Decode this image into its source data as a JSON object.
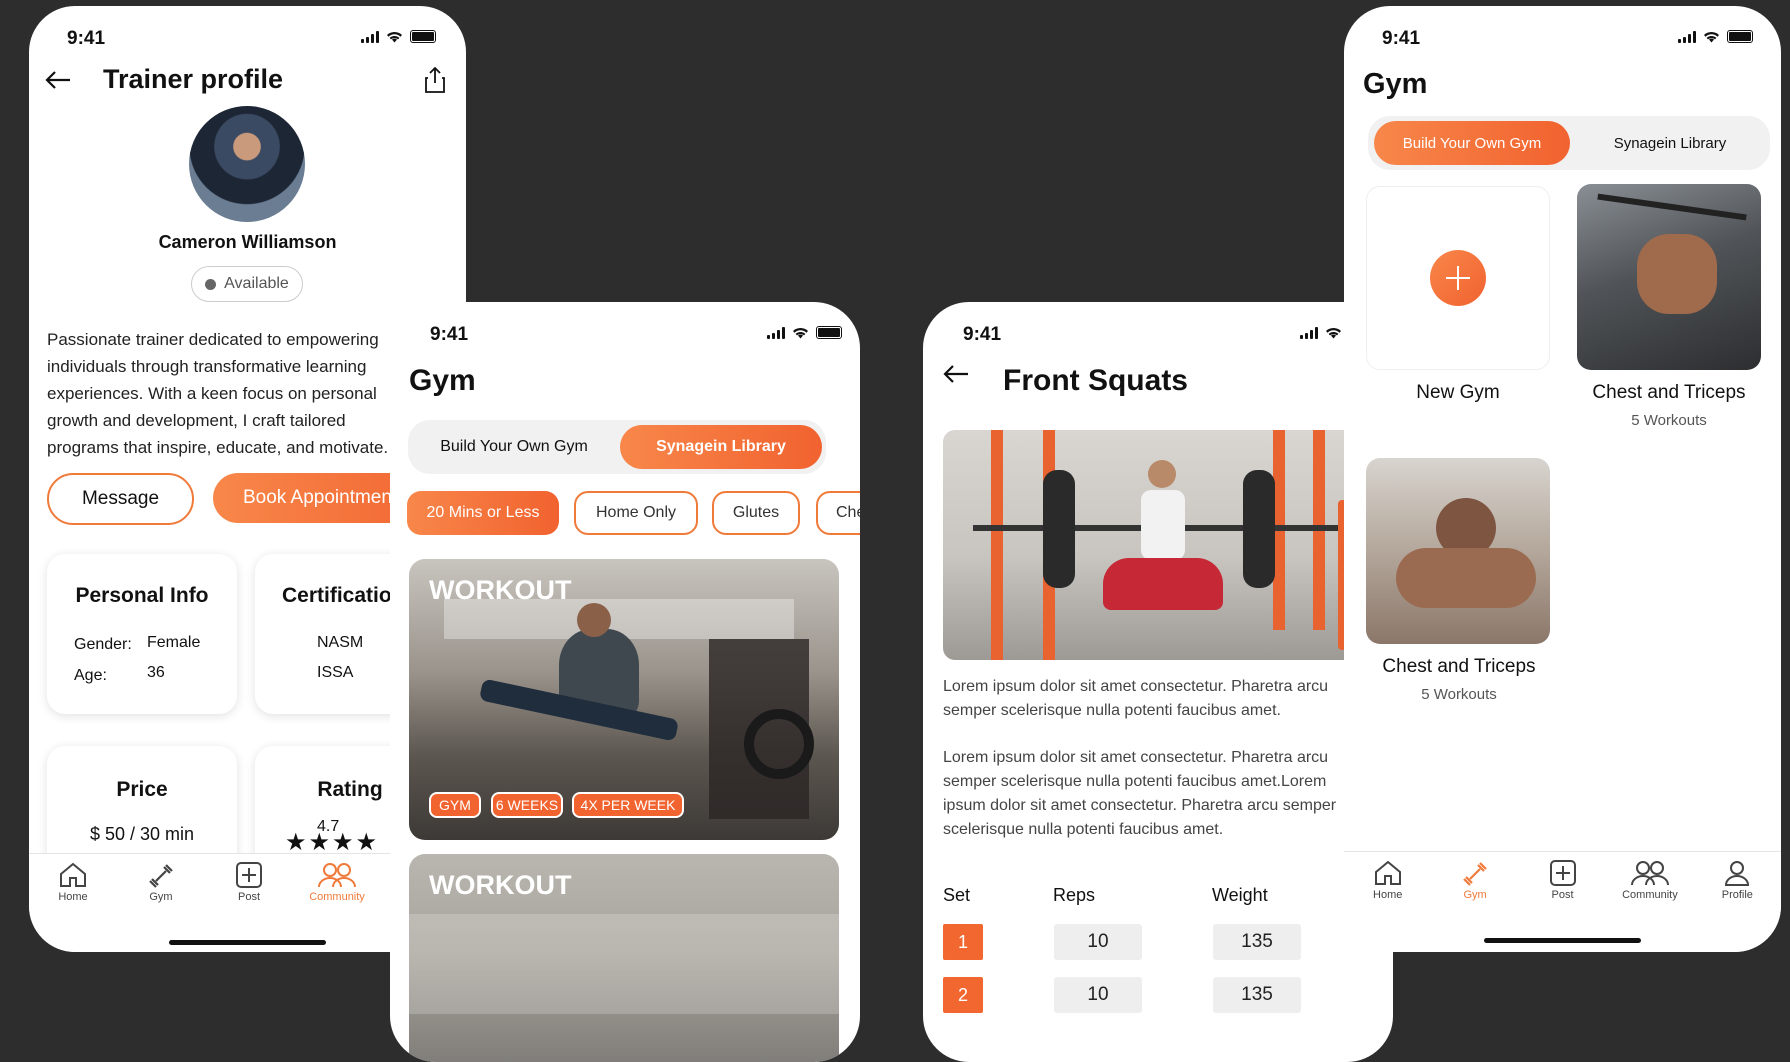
{
  "status_time": "9:41",
  "trainer": {
    "title": "Trainer profile",
    "name": "Cameron Williamson",
    "availability": "Available",
    "bio": "Passionate trainer dedicated to empowering individuals through transformative learning experiences. With a keen focus on personal growth and development, I craft tailored programs that inspire, educate, and motivate.",
    "message_label": "Message",
    "book_label": "Book Appointment",
    "personal_info": {
      "heading": "Personal Info",
      "gender_label": "Gender:",
      "gender": "Female",
      "age_label": "Age:",
      "age": "36"
    },
    "certifications": {
      "heading": "Certifications",
      "items": [
        "NASM",
        "ISSA"
      ]
    },
    "price": {
      "heading": "Price",
      "currency": "$",
      "amount": "50",
      "unit": "/ 30 min"
    },
    "rating": {
      "heading": "Rating",
      "value": "4.7",
      "stars": 4
    }
  },
  "gym_library": {
    "title": "Gym",
    "seg_build": "Build Your Own Gym",
    "seg_library": "Synagein Library",
    "filters": [
      "20 Mins or Less",
      "Home Only",
      "Glutes",
      "Chest"
    ],
    "card1": {
      "label": "WORKOUT",
      "tags": [
        "GYM",
        "6 WEEKS",
        "4X PER WEEK"
      ]
    },
    "card2": {
      "label": "WORKOUT"
    }
  },
  "exercise": {
    "title": "Front Squats",
    "para1": "Lorem ipsum dolor sit amet consectetur. Pharetra arcu semper scelerisque nulla potenti faucibus amet.",
    "para2": "Lorem ipsum dolor sit amet consectetur. Pharetra arcu semper scelerisque nulla potenti faucibus amet.Lorem ipsum dolor sit amet consectetur. Pharetra arcu semper scelerisque nulla potenti faucibus amet.",
    "table_headers": {
      "set": "Set",
      "reps": "Reps",
      "weight": "Weight"
    },
    "rows": [
      {
        "set": "1",
        "reps": "10",
        "weight": "135"
      },
      {
        "set": "2",
        "reps": "10",
        "weight": "135"
      }
    ]
  },
  "gym_build": {
    "title": "Gym",
    "seg_build": "Build Your Own Gym",
    "seg_library": "Synagein Library",
    "new_gym": "New Gym",
    "gym1": {
      "name": "Chest and Triceps",
      "count": "5 Workouts"
    },
    "gym2": {
      "name": "Chest and Triceps",
      "count": "5 Workouts"
    }
  },
  "tabs_trainer": [
    {
      "label": "Home",
      "icon": "home-icon"
    },
    {
      "label": "Gym",
      "icon": "dumbbell-icon"
    },
    {
      "label": "Post",
      "icon": "plus-square-icon"
    },
    {
      "label": "Community",
      "icon": "community-icon",
      "active": true
    }
  ],
  "tabs_gym": [
    {
      "label": "Home",
      "icon": "home-icon"
    },
    {
      "label": "Gym",
      "icon": "dumbbell-icon",
      "active": true
    },
    {
      "label": "Post",
      "icon": "plus-square-icon"
    },
    {
      "label": "Community",
      "icon": "community-icon"
    },
    {
      "label": "Profile",
      "icon": "profile-icon"
    }
  ],
  "colors": {
    "accent": "#f07a3a",
    "background": "#2d2d2e"
  }
}
